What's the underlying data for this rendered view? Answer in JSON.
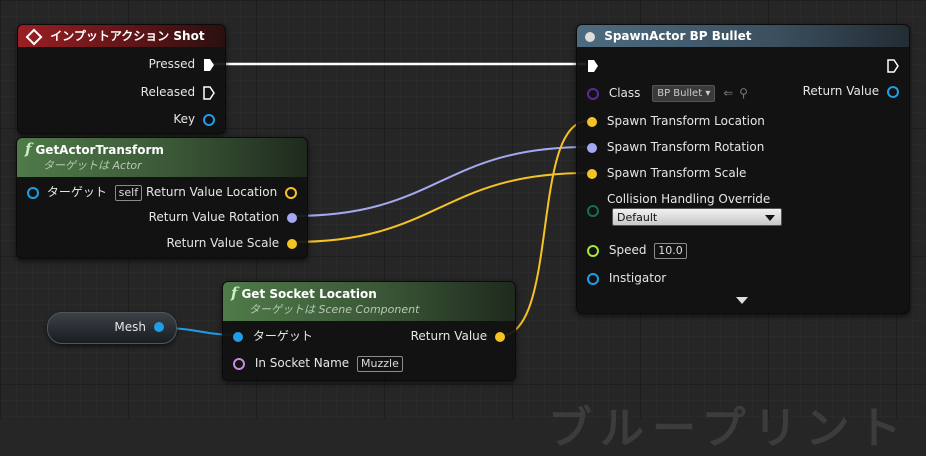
{
  "watermark": "ブループリント",
  "nodes": {
    "input_action": {
      "title": "インプットアクション Shot",
      "pins": {
        "pressed": "Pressed",
        "released": "Released",
        "key": "Key"
      }
    },
    "get_actor_transform": {
      "title": "GetActorTransform",
      "subtitle": "ターゲットは Actor",
      "target_label": "ターゲット",
      "target_value": "self",
      "pins": {
        "location": "Return Value Location",
        "rotation": "Return Value Rotation",
        "scale": "Return Value Scale"
      }
    },
    "mesh": {
      "label": "Mesh"
    },
    "get_socket_location": {
      "title": "Get Socket Location",
      "subtitle": "ターゲットは Scene Component",
      "target_label": "ターゲット",
      "return_label": "Return Value",
      "socket_label": "In Socket Name",
      "socket_value": "Muzzle"
    },
    "spawn_actor": {
      "title": "SpawnActor BP Bullet",
      "class_label": "Class",
      "class_value": "BP Bullet",
      "return_label": "Return Value",
      "location_label": "Spawn Transform Location",
      "rotation_label": "Spawn Transform Rotation",
      "scale_label": "Spawn Transform Scale",
      "collision_label": "Collision Handling Override",
      "collision_value": "Default",
      "speed_label": "Speed",
      "speed_value": "10.0",
      "instigator_label": "Instigator"
    }
  },
  "colors": {
    "exec": "#ffffff",
    "vector": "#f5c323",
    "rotator": "#a4a9ef",
    "object": "#1e9ee8",
    "float": "#a8e83a",
    "class": "#5a2a9a",
    "struct": "#1a6b55",
    "name": "#c38de0"
  }
}
